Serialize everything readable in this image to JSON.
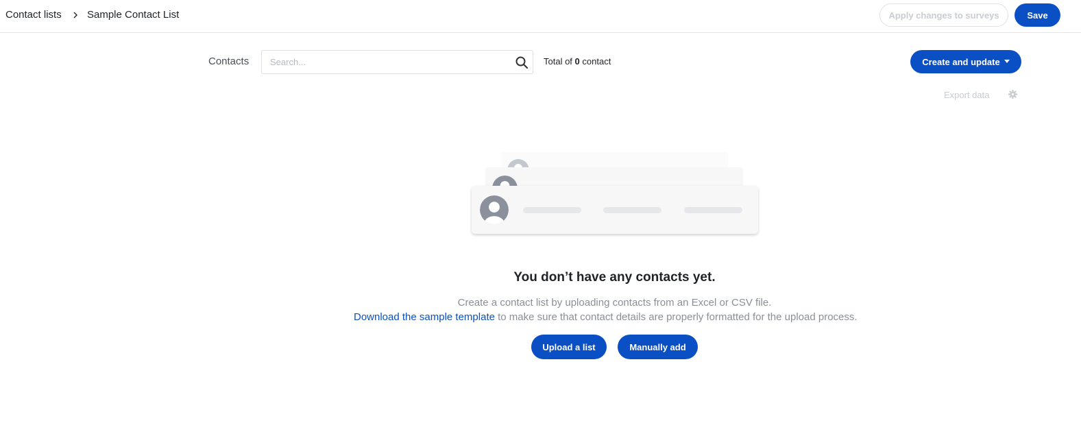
{
  "breadcrumb": {
    "root": "Contact lists",
    "current": "Sample Contact List"
  },
  "header": {
    "apply_label": "Apply changes to surveys",
    "save_label": "Save"
  },
  "contacts": {
    "label": "Contacts",
    "search_placeholder": "Search...",
    "total_prefix": "Total of",
    "total_count": "0",
    "total_suffix": "contact"
  },
  "actions": {
    "create_update_label": "Create and update",
    "export_label": "Export data"
  },
  "empty_state": {
    "title": "You don’t have any contacts yet.",
    "line1": "Create a contact list by uploading contacts from an Excel or CSV file.",
    "link_text": "Download the sample template",
    "line2_rest": " to make sure that contact details are properly formatted for the upload process.",
    "upload_label": "Upload a list",
    "manual_label": "Manually add"
  },
  "icons": {
    "chevron": "chevron-right-icon",
    "search": "search-icon",
    "caret": "caret-down-icon",
    "gear": "gear-icon",
    "avatar": "avatar-icon"
  },
  "colors": {
    "primary": "#0b4fc4",
    "disabled_text": "#c9ccd1",
    "muted_text": "#8a8f97",
    "avatar_gray": "#8a919c"
  }
}
